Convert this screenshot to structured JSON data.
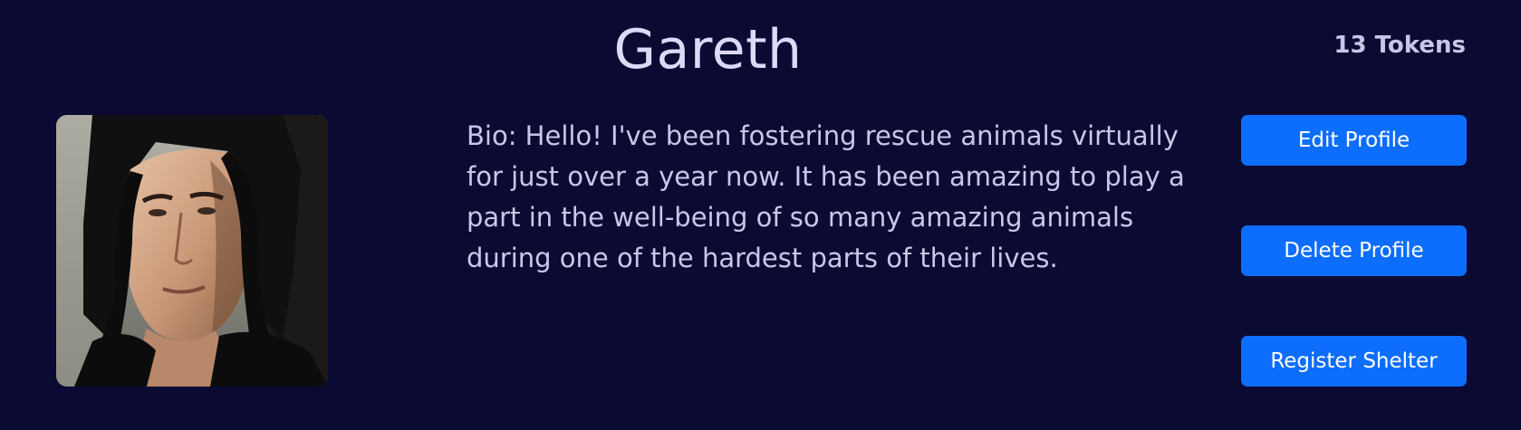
{
  "profile": {
    "name": "Gareth",
    "tokens": "13 Tokens",
    "bio": "Bio: Hello! I've been fostering rescue animals virtually for just over a year now. It has been amazing to play a part in the well-being of so many amazing animals during one of the hardest parts of their lives."
  },
  "actions": {
    "edit_label": "Edit Profile",
    "delete_label": "Delete Profile",
    "register_label": "Register Shelter"
  },
  "colors": {
    "background": "#0a0a33",
    "button": "#0d6efd",
    "text": "#c9c7e8"
  }
}
